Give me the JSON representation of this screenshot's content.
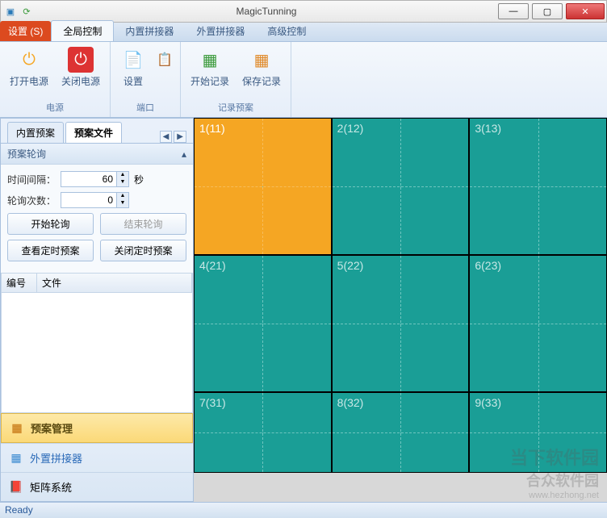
{
  "window": {
    "title": "MagicTunning"
  },
  "ribbon_tabs": {
    "settings": "设置 (S)",
    "items": [
      "全局控制",
      "内置拼接器",
      "外置拼接器",
      "高级控制"
    ],
    "active": 0
  },
  "ribbon": {
    "power": {
      "title": "电源",
      "open": "打开电源",
      "close": "关闭电源"
    },
    "port": {
      "title": "端口",
      "settings": "设置"
    },
    "record": {
      "title": "记录预案",
      "start": "开始记录",
      "save": "保存记录"
    }
  },
  "panel": {
    "tabs": {
      "builtin": "内置预案",
      "file": "预案文件",
      "nav_left": "◀",
      "nav_right": "▶"
    },
    "polling": {
      "header": "预案轮询",
      "interval_label": "时间间隔：",
      "interval_value": "60",
      "interval_unit": "秒",
      "count_label": "轮询次数：",
      "count_value": "0",
      "start": "开始轮询",
      "stop": "结束轮询",
      "view_timer": "查看定时预案",
      "close_timer": "关闭定时预案"
    },
    "table": {
      "col_id": "编号",
      "col_file": "文件"
    },
    "nav": {
      "plan_mgmt": "预案管理",
      "external": "外置拼接器",
      "matrix": "矩阵系统"
    }
  },
  "grid": {
    "cells": [
      {
        "label": "1(11)",
        "color": "orange"
      },
      {
        "label": "2(12)",
        "color": "teal"
      },
      {
        "label": "3(13)",
        "color": "teal"
      },
      {
        "label": "4(21)",
        "color": "teal"
      },
      {
        "label": "5(22)",
        "color": "teal"
      },
      {
        "label": "6(23)",
        "color": "teal"
      },
      {
        "label": "7(31)",
        "color": "teal"
      },
      {
        "label": "8(32)",
        "color": "teal"
      },
      {
        "label": "9(33)",
        "color": "teal"
      }
    ]
  },
  "status": {
    "text": "Ready"
  },
  "watermark": {
    "line1": "当下软件园",
    "line2": "合众软件园",
    "url": "www.hezhong.net"
  }
}
